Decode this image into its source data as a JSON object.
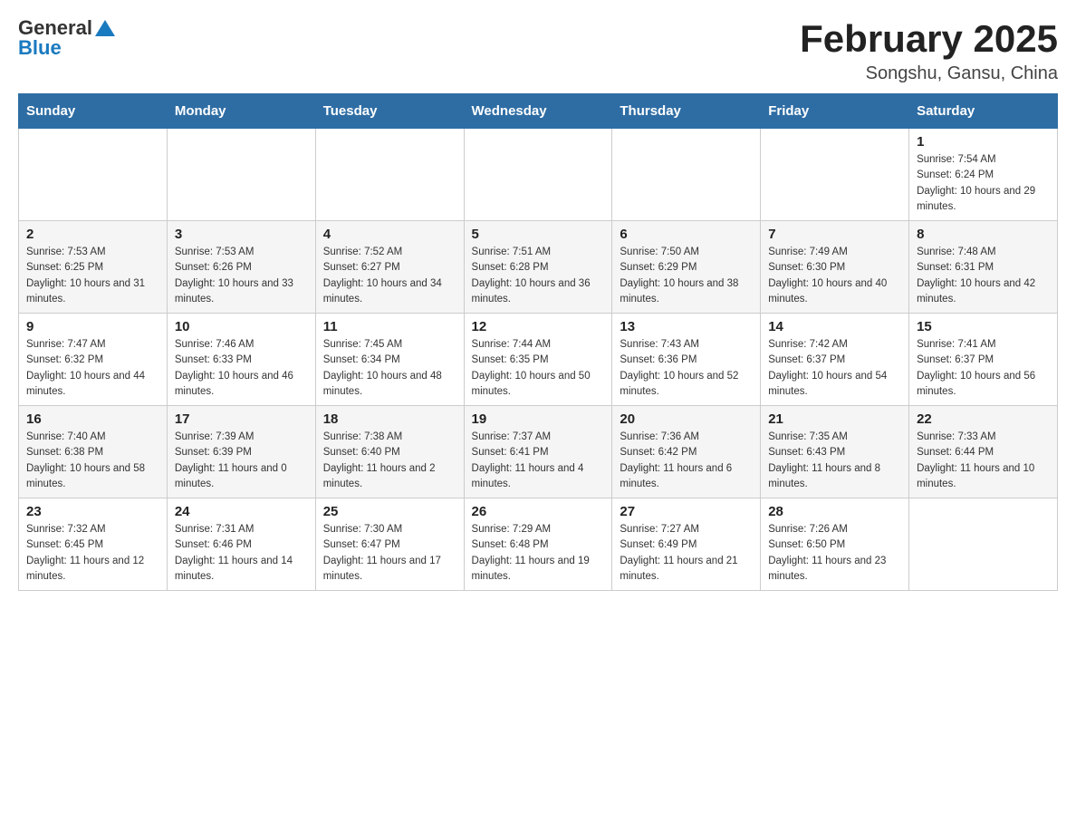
{
  "header": {
    "logo_general": "General",
    "logo_blue": "Blue",
    "title": "February 2025",
    "subtitle": "Songshu, Gansu, China"
  },
  "days_of_week": [
    "Sunday",
    "Monday",
    "Tuesday",
    "Wednesday",
    "Thursday",
    "Friday",
    "Saturday"
  ],
  "weeks": [
    {
      "days": [
        {
          "num": "",
          "sunrise": "",
          "sunset": "",
          "daylight": ""
        },
        {
          "num": "",
          "sunrise": "",
          "sunset": "",
          "daylight": ""
        },
        {
          "num": "",
          "sunrise": "",
          "sunset": "",
          "daylight": ""
        },
        {
          "num": "",
          "sunrise": "",
          "sunset": "",
          "daylight": ""
        },
        {
          "num": "",
          "sunrise": "",
          "sunset": "",
          "daylight": ""
        },
        {
          "num": "",
          "sunrise": "",
          "sunset": "",
          "daylight": ""
        },
        {
          "num": "1",
          "sunrise": "Sunrise: 7:54 AM",
          "sunset": "Sunset: 6:24 PM",
          "daylight": "Daylight: 10 hours and 29 minutes."
        }
      ]
    },
    {
      "days": [
        {
          "num": "2",
          "sunrise": "Sunrise: 7:53 AM",
          "sunset": "Sunset: 6:25 PM",
          "daylight": "Daylight: 10 hours and 31 minutes."
        },
        {
          "num": "3",
          "sunrise": "Sunrise: 7:53 AM",
          "sunset": "Sunset: 6:26 PM",
          "daylight": "Daylight: 10 hours and 33 minutes."
        },
        {
          "num": "4",
          "sunrise": "Sunrise: 7:52 AM",
          "sunset": "Sunset: 6:27 PM",
          "daylight": "Daylight: 10 hours and 34 minutes."
        },
        {
          "num": "5",
          "sunrise": "Sunrise: 7:51 AM",
          "sunset": "Sunset: 6:28 PM",
          "daylight": "Daylight: 10 hours and 36 minutes."
        },
        {
          "num": "6",
          "sunrise": "Sunrise: 7:50 AM",
          "sunset": "Sunset: 6:29 PM",
          "daylight": "Daylight: 10 hours and 38 minutes."
        },
        {
          "num": "7",
          "sunrise": "Sunrise: 7:49 AM",
          "sunset": "Sunset: 6:30 PM",
          "daylight": "Daylight: 10 hours and 40 minutes."
        },
        {
          "num": "8",
          "sunrise": "Sunrise: 7:48 AM",
          "sunset": "Sunset: 6:31 PM",
          "daylight": "Daylight: 10 hours and 42 minutes."
        }
      ]
    },
    {
      "days": [
        {
          "num": "9",
          "sunrise": "Sunrise: 7:47 AM",
          "sunset": "Sunset: 6:32 PM",
          "daylight": "Daylight: 10 hours and 44 minutes."
        },
        {
          "num": "10",
          "sunrise": "Sunrise: 7:46 AM",
          "sunset": "Sunset: 6:33 PM",
          "daylight": "Daylight: 10 hours and 46 minutes."
        },
        {
          "num": "11",
          "sunrise": "Sunrise: 7:45 AM",
          "sunset": "Sunset: 6:34 PM",
          "daylight": "Daylight: 10 hours and 48 minutes."
        },
        {
          "num": "12",
          "sunrise": "Sunrise: 7:44 AM",
          "sunset": "Sunset: 6:35 PM",
          "daylight": "Daylight: 10 hours and 50 minutes."
        },
        {
          "num": "13",
          "sunrise": "Sunrise: 7:43 AM",
          "sunset": "Sunset: 6:36 PM",
          "daylight": "Daylight: 10 hours and 52 minutes."
        },
        {
          "num": "14",
          "sunrise": "Sunrise: 7:42 AM",
          "sunset": "Sunset: 6:37 PM",
          "daylight": "Daylight: 10 hours and 54 minutes."
        },
        {
          "num": "15",
          "sunrise": "Sunrise: 7:41 AM",
          "sunset": "Sunset: 6:37 PM",
          "daylight": "Daylight: 10 hours and 56 minutes."
        }
      ]
    },
    {
      "days": [
        {
          "num": "16",
          "sunrise": "Sunrise: 7:40 AM",
          "sunset": "Sunset: 6:38 PM",
          "daylight": "Daylight: 10 hours and 58 minutes."
        },
        {
          "num": "17",
          "sunrise": "Sunrise: 7:39 AM",
          "sunset": "Sunset: 6:39 PM",
          "daylight": "Daylight: 11 hours and 0 minutes."
        },
        {
          "num": "18",
          "sunrise": "Sunrise: 7:38 AM",
          "sunset": "Sunset: 6:40 PM",
          "daylight": "Daylight: 11 hours and 2 minutes."
        },
        {
          "num": "19",
          "sunrise": "Sunrise: 7:37 AM",
          "sunset": "Sunset: 6:41 PM",
          "daylight": "Daylight: 11 hours and 4 minutes."
        },
        {
          "num": "20",
          "sunrise": "Sunrise: 7:36 AM",
          "sunset": "Sunset: 6:42 PM",
          "daylight": "Daylight: 11 hours and 6 minutes."
        },
        {
          "num": "21",
          "sunrise": "Sunrise: 7:35 AM",
          "sunset": "Sunset: 6:43 PM",
          "daylight": "Daylight: 11 hours and 8 minutes."
        },
        {
          "num": "22",
          "sunrise": "Sunrise: 7:33 AM",
          "sunset": "Sunset: 6:44 PM",
          "daylight": "Daylight: 11 hours and 10 minutes."
        }
      ]
    },
    {
      "days": [
        {
          "num": "23",
          "sunrise": "Sunrise: 7:32 AM",
          "sunset": "Sunset: 6:45 PM",
          "daylight": "Daylight: 11 hours and 12 minutes."
        },
        {
          "num": "24",
          "sunrise": "Sunrise: 7:31 AM",
          "sunset": "Sunset: 6:46 PM",
          "daylight": "Daylight: 11 hours and 14 minutes."
        },
        {
          "num": "25",
          "sunrise": "Sunrise: 7:30 AM",
          "sunset": "Sunset: 6:47 PM",
          "daylight": "Daylight: 11 hours and 17 minutes."
        },
        {
          "num": "26",
          "sunrise": "Sunrise: 7:29 AM",
          "sunset": "Sunset: 6:48 PM",
          "daylight": "Daylight: 11 hours and 19 minutes."
        },
        {
          "num": "27",
          "sunrise": "Sunrise: 7:27 AM",
          "sunset": "Sunset: 6:49 PM",
          "daylight": "Daylight: 11 hours and 21 minutes."
        },
        {
          "num": "28",
          "sunrise": "Sunrise: 7:26 AM",
          "sunset": "Sunset: 6:50 PM",
          "daylight": "Daylight: 11 hours and 23 minutes."
        },
        {
          "num": "",
          "sunrise": "",
          "sunset": "",
          "daylight": ""
        }
      ]
    }
  ]
}
